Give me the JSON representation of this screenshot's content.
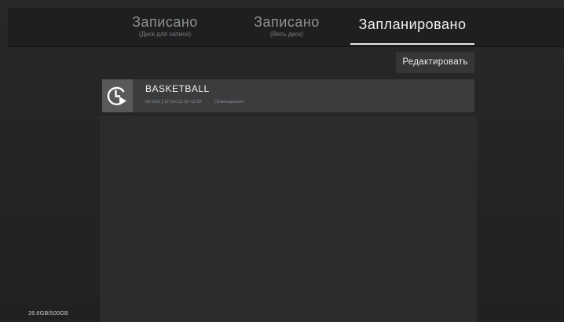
{
  "tabs": [
    {
      "title": "Записано",
      "subtitle": "(Диск для записи)",
      "active": false
    },
    {
      "title": "Записано",
      "subtitle": "(Весь диск)",
      "active": false
    },
    {
      "title": "Запланировано",
      "subtitle": "",
      "active": true
    }
  ],
  "toolbar": {
    "edit_label": "Редактировать"
  },
  "schedule": {
    "items": [
      {
        "title": "BASKETBALL",
        "channel": "53 CH5",
        "datetime": "12 Oct 11:10~12:20",
        "repeat": "Еженедельно",
        "icon": "scheduled-clock-play-icon"
      }
    ]
  },
  "storage": {
    "usage": "26.6GB/500GB"
  },
  "colors": {
    "background": "#222426",
    "top_bar": "#1e1f21",
    "panel": "#2a2c2e",
    "list_item": "#3a3c3e",
    "icon_tile": "#57595b",
    "active_underline": "#e6e6e6"
  }
}
